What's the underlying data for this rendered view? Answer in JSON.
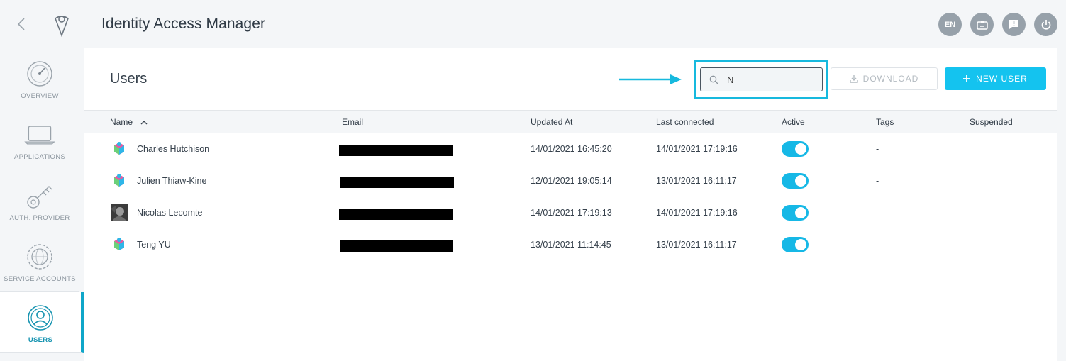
{
  "app": {
    "title": "Identity Access Manager"
  },
  "topbar": {
    "language": "EN"
  },
  "sidebar": {
    "items": [
      {
        "label": "OVERVIEW",
        "icon": "gauge-icon",
        "active": false
      },
      {
        "label": "APPLICATIONS",
        "icon": "laptop-icon",
        "active": false
      },
      {
        "label": "AUTH. PROVIDER",
        "icon": "key-icon",
        "active": false
      },
      {
        "label": "SERVICE ACCOUNTS",
        "icon": "gear-globe-icon",
        "active": false
      },
      {
        "label": "USERS",
        "icon": "user-circle-icon",
        "active": true
      }
    ]
  },
  "main": {
    "title": "Users",
    "search": {
      "value": "N",
      "placeholder": ""
    },
    "download_label": "DOWNLOAD",
    "new_user_label": "NEW USER",
    "table": {
      "columns": [
        "Name",
        "Email",
        "Updated At",
        "Last connected",
        "Active",
        "Tags",
        "Suspended"
      ],
      "rows": [
        {
          "name": "Charles Hutchison",
          "updated_at": "14/01/2021 16:45:20",
          "last_connected": "14/01/2021 17:19:16",
          "active": true,
          "tags": "-"
        },
        {
          "name": "Julien Thiaw-Kine",
          "updated_at": "12/01/2021 19:05:14",
          "last_connected": "13/01/2021 16:11:17",
          "active": true,
          "tags": "-"
        },
        {
          "name": "Nicolas Lecomte",
          "updated_at": "14/01/2021 17:19:13",
          "last_connected": "14/01/2021 17:19:16",
          "active": true,
          "tags": "-"
        },
        {
          "name": "Teng YU",
          "updated_at": "13/01/2021 11:14:45",
          "last_connected": "13/01/2021 16:11:17",
          "active": true,
          "tags": "-"
        }
      ]
    }
  },
  "colors": {
    "accent": "#14c3ef",
    "highlight": "#17b9de",
    "toggle": "#16b8e6",
    "active_nav": "#0fa6c9"
  }
}
